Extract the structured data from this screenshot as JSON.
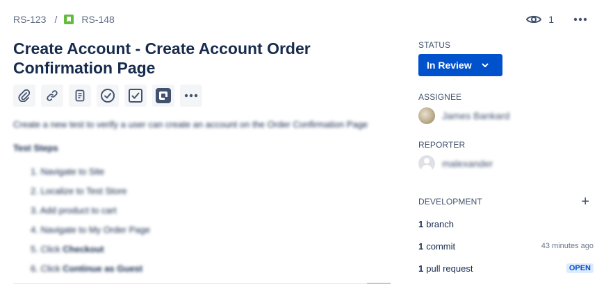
{
  "breadcrumb": {
    "parent": "RS-123",
    "separator": "/",
    "current": "RS-148"
  },
  "watchers": {
    "count": "1"
  },
  "issue": {
    "title": "Create Account - Create Account Order Confirmation Page"
  },
  "toolbar": {
    "icons": [
      "attach-icon",
      "link-icon",
      "page-icon",
      "check-circle-icon",
      "checkbox-icon",
      "app-icon",
      "more-icon"
    ]
  },
  "description": {
    "intro": "Create a new test to verify a user can create an account on the Order Confirmation Page",
    "steps_heading": "Test Steps",
    "steps": [
      {
        "num": "1.",
        "text": "Navigate to Site"
      },
      {
        "num": "2.",
        "text": "Localize to Test Store"
      },
      {
        "num": "3.",
        "text": "Add product to cart"
      },
      {
        "num": "4.",
        "text": "Navigate to My Order Page"
      },
      {
        "num": "5.",
        "text": "Click",
        "bold": "Checkout"
      },
      {
        "num": "6.",
        "text": "Click",
        "bold": "Continue as Guest"
      }
    ]
  },
  "sidebar": {
    "status_label": "STATUS",
    "status_value": "In Review",
    "assignee_label": "ASSIGNEE",
    "assignee_name": "James Bankard",
    "reporter_label": "REPORTER",
    "reporter_name": "malexander",
    "development_label": "DEVELOPMENT",
    "dev": {
      "branch": {
        "count": "1",
        "label": "branch"
      },
      "commit": {
        "count": "1",
        "label": "commit",
        "time": "43 minutes ago"
      },
      "pr": {
        "count": "1",
        "label": "pull request",
        "badge": "OPEN"
      }
    }
  },
  "colors": {
    "primary": "#0052cc",
    "story": "#63ba3c",
    "text": "#172b4d",
    "subtle": "#5e6c84"
  }
}
